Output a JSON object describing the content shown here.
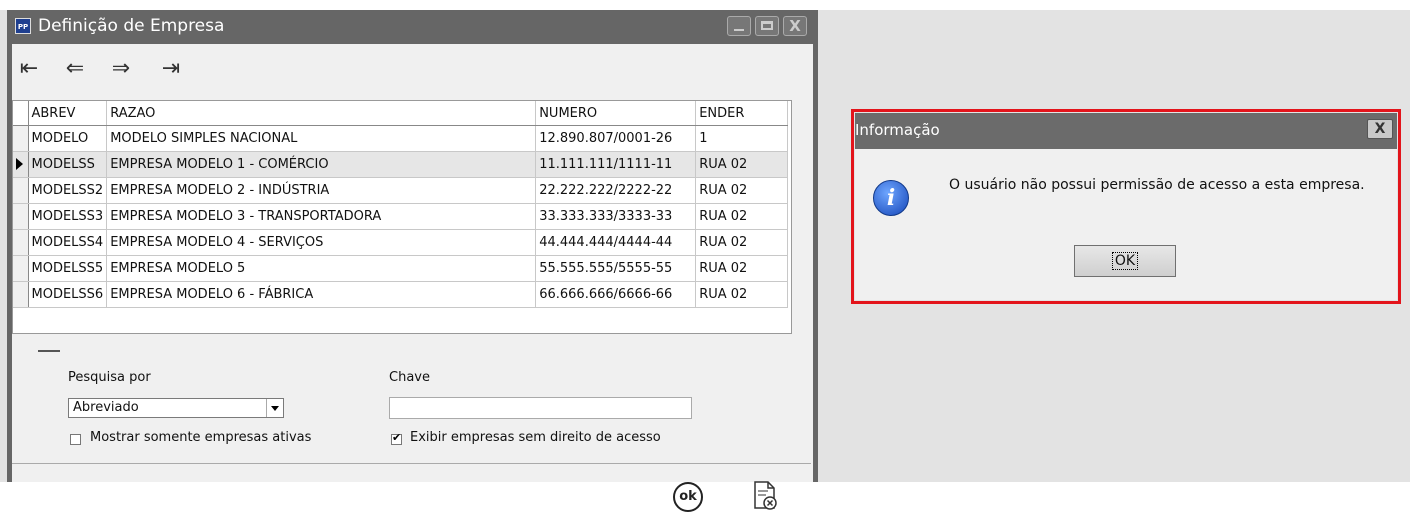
{
  "window": {
    "title": "Definição de Empresa",
    "icon_text": "PP",
    "close_glyph": "X"
  },
  "nav": {
    "first": "⇤",
    "prev": "⇐",
    "next": "⇒",
    "last": "⇥"
  },
  "grid": {
    "columns": [
      "ABREV",
      "RAZAO",
      "NUMERO",
      "ENDER"
    ],
    "rows": [
      [
        "MODELO",
        "MODELO SIMPLES NACIONAL",
        "12.890.807/0001-26",
        "1"
      ],
      [
        "MODELSS",
        "EMPRESA MODELO 1 - COMÉRCIO",
        "11.111.111/1111-11",
        "RUA 02"
      ],
      [
        "MODELSS2",
        "EMPRESA MODELO 2 - INDÚSTRIA",
        "22.222.222/2222-22",
        "RUA 02"
      ],
      [
        "MODELSS3",
        "EMPRESA MODELO 3 - TRANSPORTADORA",
        "33.333.333/3333-33",
        "RUA 02"
      ],
      [
        "MODELSS4",
        "EMPRESA MODELO 4 - SERVIÇOS",
        "44.444.444/4444-44",
        "RUA 02"
      ],
      [
        "MODELSS5",
        "EMPRESA MODELO 5",
        "55.555.555/5555-55",
        "RUA 02"
      ],
      [
        "MODELSS6",
        "EMPRESA MODELO 6 - FÁBRICA",
        "66.666.666/6666-66",
        "RUA 02"
      ]
    ],
    "selected_row": 1
  },
  "search": {
    "pesquisa_label": "Pesquisa por",
    "pesquisa_value": "Abreviado",
    "chave_label": "Chave",
    "chave_value": "",
    "ativas_label": "Mostrar somente empresas ativas",
    "ativas_checked": false,
    "sem_direito_label": "Exibir empresas sem direito de acesso",
    "sem_direito_checked": true
  },
  "footer": {
    "ok_label": "ok"
  },
  "dialog": {
    "title": "Informação",
    "close_glyph": "X",
    "message": "O usuário não possui permissão de acesso a esta empresa.",
    "ok_label": "OK",
    "highlight_color": "#e3141b"
  }
}
